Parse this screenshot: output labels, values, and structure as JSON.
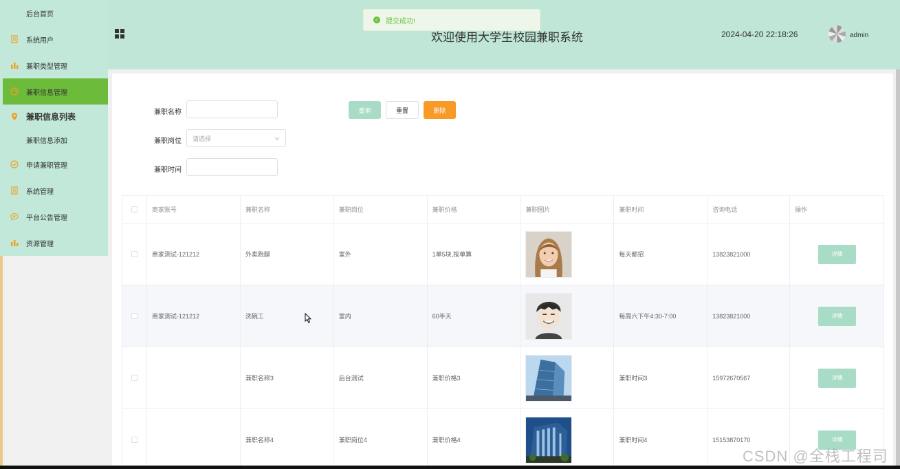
{
  "sidebar": {
    "items": [
      {
        "label": "后台首页",
        "icon": "home-icon"
      },
      {
        "label": "系统用户",
        "icon": "document-icon"
      },
      {
        "label": "兼职类型管理",
        "icon": "bar-chart-icon"
      },
      {
        "label": "兼职信息管理",
        "icon": "palette-icon"
      },
      {
        "label": "兼职信息列表",
        "icon": "location-pin-icon"
      },
      {
        "label": "兼职信息添加",
        "icon": ""
      },
      {
        "label": "申请兼职管理",
        "icon": "check-circle-icon"
      },
      {
        "label": "系统管理",
        "icon": "document-icon"
      },
      {
        "label": "平台公告管理",
        "icon": "chat-icon"
      },
      {
        "label": "资源管理",
        "icon": "bar-chart-icon"
      }
    ],
    "accent_color": "#6dbb3b"
  },
  "header": {
    "title": "欢迎使用大学生校园兼职系统",
    "datetime": "2024-04-20 22:18:26",
    "username": "admin"
  },
  "toast": {
    "message": "提交成功!"
  },
  "search": {
    "name_label": "兼职名称",
    "name_value": "",
    "position_label": "兼职岗位",
    "position_placeholder": "请选择",
    "time_label": "兼职时间",
    "time_value": "",
    "query_label": "查询",
    "reset_label": "重置",
    "delete_label": "删除"
  },
  "table": {
    "columns": [
      "商家账号",
      "兼职名称",
      "兼职岗位",
      "兼职价格",
      "兼职图片",
      "兼职时间",
      "咨询电话",
      "操作"
    ],
    "rows": [
      {
        "account": "商家测试-121212",
        "name": "外卖跑腿",
        "position": "室外",
        "price": "1单5块,按单算",
        "image": "woman-portrait",
        "time": "每天都招",
        "phone": "13823821000",
        "action": "详情"
      },
      {
        "account": "商家测试-121212",
        "name": "洗碗工",
        "position": "室内",
        "price": "60半天",
        "image": "cartoon-man",
        "time": "每周六下午4:30-7:00",
        "phone": "13823821000",
        "action": "详情"
      },
      {
        "account": "",
        "name": "兼职名称3",
        "position": "后台测试",
        "price": "兼职价格3",
        "image": "glass-building",
        "time": "兼职时间3",
        "phone": "15972670567",
        "action": "详情"
      },
      {
        "account": "",
        "name": "兼职名称4",
        "position": "兼职岗位4",
        "price": "兼职价格4",
        "image": "office-building",
        "time": "兼职时间4",
        "phone": "15153870170",
        "action": "详情"
      }
    ]
  },
  "watermark": "CSDN @全栈工程司"
}
